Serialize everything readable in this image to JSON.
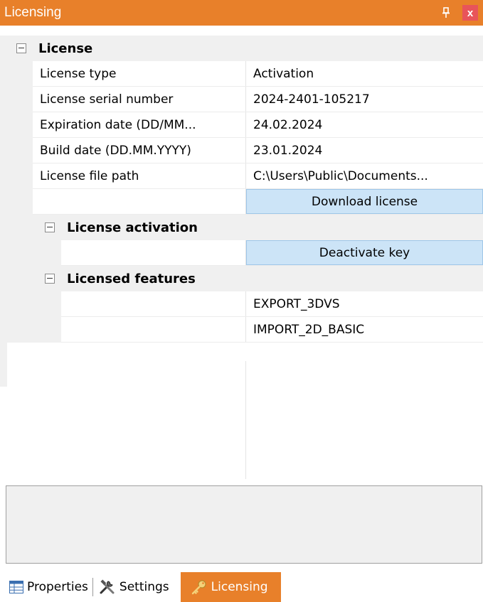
{
  "window": {
    "title": "Licensing",
    "pin_glyph": "♇",
    "close_glyph": "x",
    "accent_color": "#e8802a"
  },
  "grid": {
    "license": {
      "category": "License",
      "rows": [
        {
          "name": "License type",
          "value": "Activation"
        },
        {
          "name": "License serial number",
          "value": "2024-2401-105217"
        },
        {
          "name": "Expiration date (DD/MM...",
          "value": "24.02.2024"
        },
        {
          "name": "Build date (DD.MM.YYYY)",
          "value": "23.01.2024"
        },
        {
          "name": "License file path",
          "value": "C:\\Users\\Public\\Documents..."
        }
      ],
      "download_button": "Download license"
    },
    "activation": {
      "category": "License activation",
      "deactivate_button": "Deactivate key"
    },
    "features": {
      "category": "Licensed features",
      "items": [
        "EXPORT_3DVS",
        "IMPORT_2D_BASIC"
      ]
    }
  },
  "description": {
    "text": ""
  },
  "tabs": [
    {
      "label": "Properties",
      "icon": "properties-grid-icon"
    },
    {
      "label": "Settings",
      "icon": "tools-icon"
    },
    {
      "label": "Licensing",
      "icon": "key-icon",
      "active": true
    }
  ]
}
